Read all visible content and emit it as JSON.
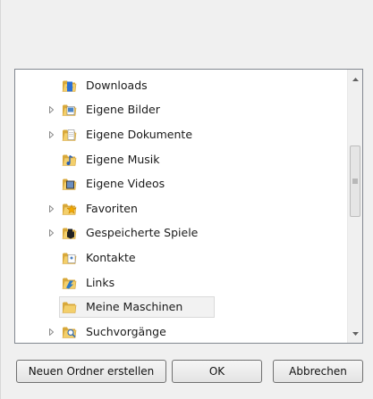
{
  "tree": {
    "items": [
      {
        "label": "Downloads",
        "expandable": false,
        "icon": "downloads-folder-icon",
        "selected": false
      },
      {
        "label": "Eigene Bilder",
        "expandable": true,
        "icon": "pictures-folder-icon",
        "selected": false
      },
      {
        "label": "Eigene Dokumente",
        "expandable": true,
        "icon": "documents-folder-icon",
        "selected": false
      },
      {
        "label": "Eigene Musik",
        "expandable": false,
        "icon": "music-folder-icon",
        "selected": false
      },
      {
        "label": "Eigene Videos",
        "expandable": false,
        "icon": "videos-folder-icon",
        "selected": false
      },
      {
        "label": "Favoriten",
        "expandable": true,
        "icon": "favorites-folder-icon",
        "selected": false
      },
      {
        "label": "Gespeicherte Spiele",
        "expandable": true,
        "icon": "saved-games-folder-icon",
        "selected": false
      },
      {
        "label": "Kontakte",
        "expandable": false,
        "icon": "contacts-folder-icon",
        "selected": false
      },
      {
        "label": "Links",
        "expandable": false,
        "icon": "links-folder-icon",
        "selected": false
      },
      {
        "label": "Meine Maschinen",
        "expandable": false,
        "icon": "folder-icon",
        "selected": true
      },
      {
        "label": "Suchvorgänge",
        "expandable": true,
        "icon": "searches-folder-icon",
        "selected": false
      }
    ]
  },
  "buttons": {
    "new_folder": "Neuen Ordner erstellen",
    "ok": "OK",
    "cancel": "Abbrechen"
  },
  "colors": {
    "folder_yellow": "#f0c860",
    "folder_dark": "#d9a93a",
    "frame_border": "#828790",
    "selection_bg": "#f2f2f2"
  }
}
